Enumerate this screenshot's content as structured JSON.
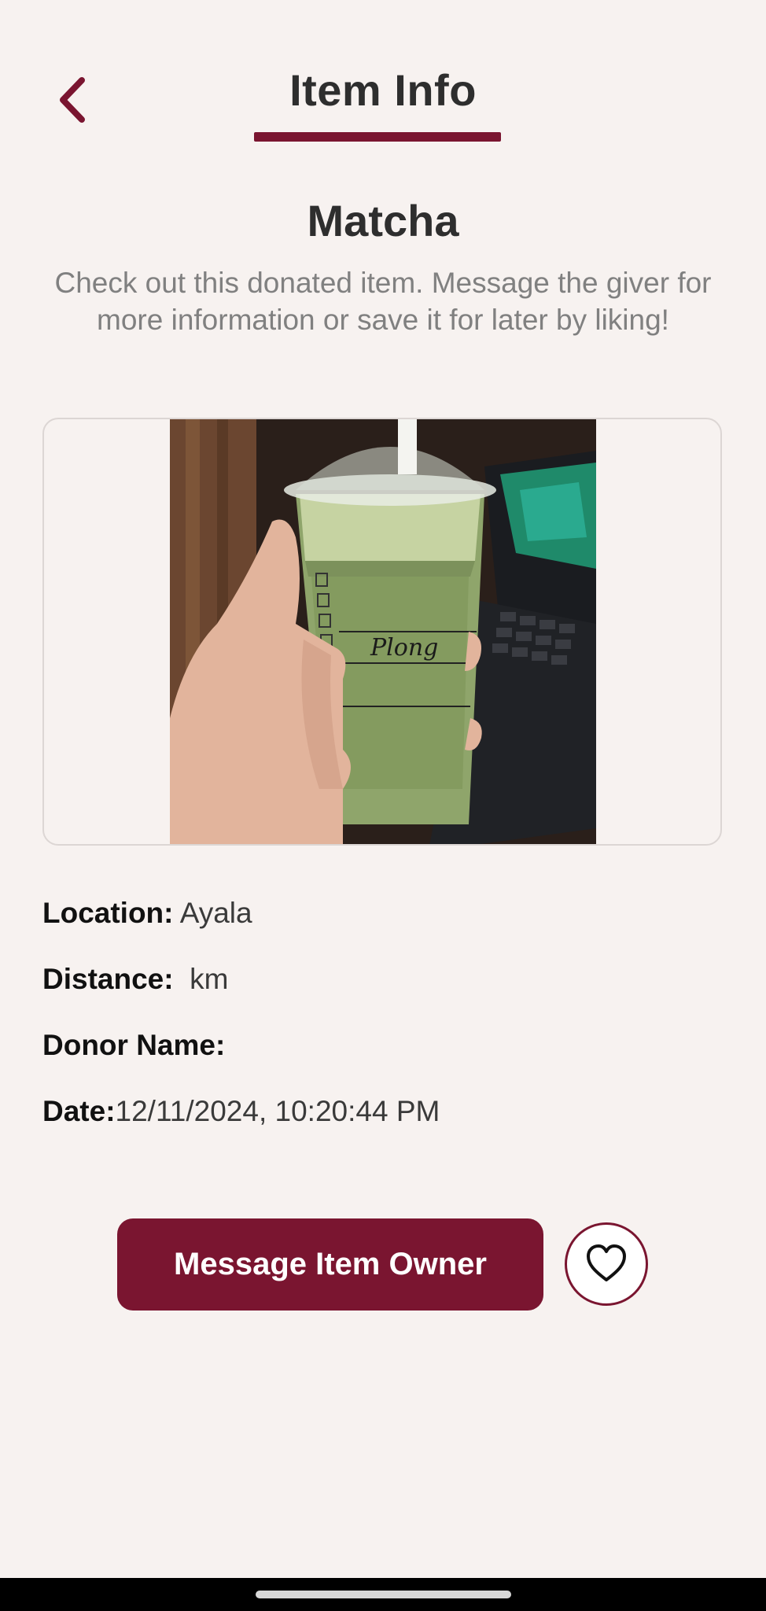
{
  "header": {
    "title": "Item Info",
    "back_icon": "chevron-left-icon"
  },
  "item": {
    "name": "Matcha",
    "description": "Check out this donated item. Message the giver for more information or save it for later by liking!",
    "photo_caption": "Plong"
  },
  "details": {
    "location_label": "Location:",
    "location_value": " Ayala",
    "distance_label": "Distance:",
    "distance_value": "  km",
    "donor_label": "Donor Name:",
    "donor_value": "",
    "date_label": "Date:",
    "date_value": "12/11/2024, 10:20:44 PM"
  },
  "actions": {
    "message_label": "Message Item Owner",
    "like_icon": "heart-icon"
  },
  "colors": {
    "accent": "#7a1530",
    "background": "#f7f2f0"
  }
}
